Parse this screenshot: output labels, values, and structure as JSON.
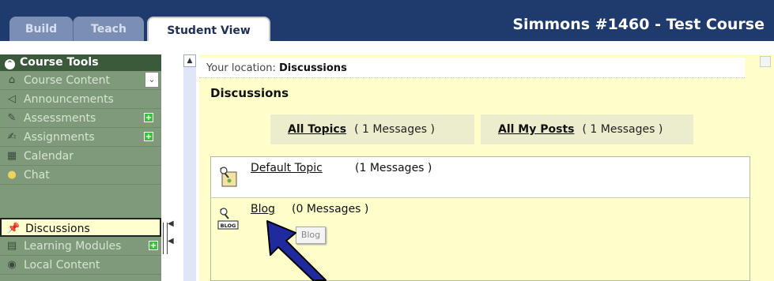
{
  "tabs": {
    "build": "Build",
    "teach": "Teach",
    "student_view": "Student View"
  },
  "course_title": "Simmons #1460 - Test Course",
  "sidebar": {
    "header": "Course Tools",
    "items": [
      {
        "label": "Course Content",
        "icon": "home-icon"
      },
      {
        "label": "Announcements",
        "icon": "megaphone-icon"
      },
      {
        "label": "Assessments",
        "icon": "assessment-icon",
        "badge": "+"
      },
      {
        "label": "Assignments",
        "icon": "assignment-icon",
        "badge": "+"
      },
      {
        "label": "Calendar",
        "icon": "calendar-icon"
      },
      {
        "label": "Chat",
        "icon": "chat-bubble-icon"
      },
      {
        "label": "Discussions",
        "icon": "pushpin-icon",
        "active": true
      },
      {
        "label": "Learning Modules",
        "icon": "module-icon",
        "badge": "+"
      },
      {
        "label": "Local Content",
        "icon": "disc-icon"
      }
    ]
  },
  "main": {
    "location_prefix": "Your location:",
    "location_value": "Discussions",
    "title": "Discussions",
    "filters": {
      "all_topics": "All Topics",
      "all_topics_count": "( 1 Messages )",
      "my_posts": "All My Posts",
      "my_posts_count": "( 1 Messages )"
    },
    "topics": [
      {
        "name": "Default Topic",
        "count": "(1 Messages )"
      },
      {
        "name": "Blog",
        "count": "(0 Messages )",
        "badge": "BLOG"
      }
    ],
    "tooltip": "Blog"
  },
  "colors": {
    "header_bg": "#1f3b6e",
    "sidebar_bg": "#7e9a7b",
    "content_bg": "#ffffcc",
    "arrow": "#1f2a9e"
  }
}
